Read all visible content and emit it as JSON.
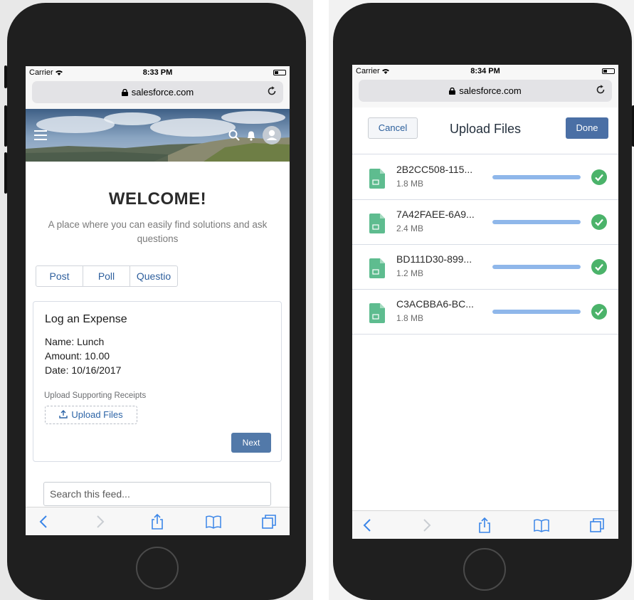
{
  "left_phone": {
    "status": {
      "carrier": "Carrier",
      "time": "8:33 PM"
    },
    "url": "salesforce.com",
    "welcome": "WELCOME!",
    "tagline": "A place where you can easily find solutions and ask questions",
    "tabs": [
      {
        "label": "Post"
      },
      {
        "label": "Poll"
      },
      {
        "label": "Questio"
      }
    ],
    "card": {
      "title": "Log an Expense",
      "name_line": "Name: Lunch",
      "amount_line": "Amount: 10.00",
      "date_line": "Date: 10/16/2017",
      "upload_label": "Upload Supporting Receipts",
      "upload_button": "Upload Files",
      "next_button": "Next"
    },
    "search_placeholder": "Search this feed..."
  },
  "right_phone": {
    "status": {
      "carrier": "Carrier",
      "time": "8:34 PM"
    },
    "url": "salesforce.com",
    "modal": {
      "title": "Upload Files",
      "cancel": "Cancel",
      "done": "Done"
    },
    "files": [
      {
        "name": "2B2CC508-115...",
        "size": "1.8 MB",
        "progress_pct": 100
      },
      {
        "name": "7A42FAEE-6A9...",
        "size": "2.4 MB",
        "progress_pct": 100
      },
      {
        "name": "BD111D30-899...",
        "size": "1.2 MB",
        "progress_pct": 100
      },
      {
        "name": "C3ACBBA6-BC...",
        "size": "1.8 MB",
        "progress_pct": 100
      }
    ]
  },
  "colors": {
    "brand_blue": "#4a6fa5",
    "link_blue": "#2b5f9c",
    "progress": "#8fb7ea",
    "success": "#4bb36a",
    "file_icon": "#5ebc8f"
  }
}
